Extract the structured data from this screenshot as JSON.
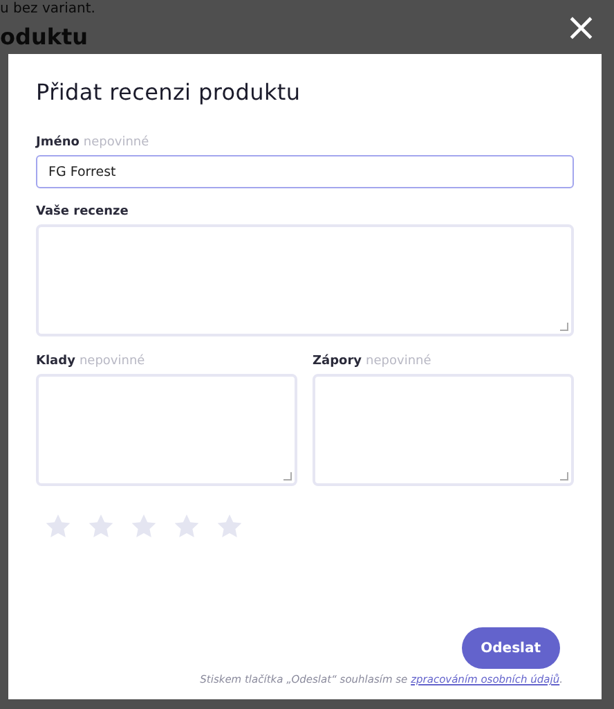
{
  "background": {
    "text": "u bez variant.",
    "heading": "oduktu"
  },
  "dialog": {
    "close": "×",
    "title": "Přidat recenzi produktu",
    "name_field": {
      "label": "Jméno",
      "hint": "nepovinné",
      "value": "FG Forrest",
      "focused": true
    },
    "review_field": {
      "label": "Vaše recenze"
    },
    "pros_field": {
      "label": "Klady",
      "hint": "nepovinné"
    },
    "cons_field": {
      "label": "Zápory",
      "hint": "nepovinné"
    },
    "rating": {
      "stars": 0
    },
    "submit": "Odeslat",
    "consent": {
      "text": "Stiskem tlačítka „Odeslat“ souhlasím se ",
      "link": "zpracováním osobních údajů",
      "end": "."
    }
  }
}
